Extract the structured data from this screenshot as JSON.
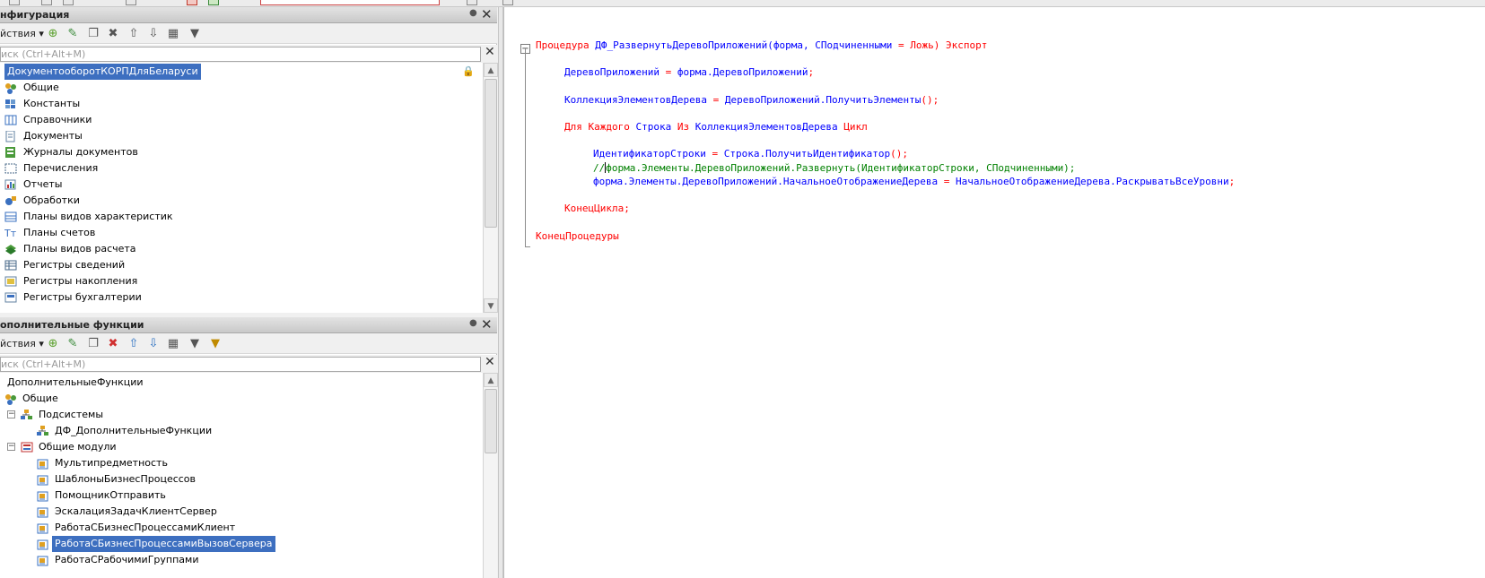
{
  "config_panel": {
    "title": "нфигурация",
    "actions_label": "йствия",
    "search_placeholder": "иск (Ctrl+Alt+M)",
    "root_label": "ДокументооборотКОРПДляБеларуси",
    "items": [
      {
        "label": "Общие",
        "icon": "common-icon"
      },
      {
        "label": "Константы",
        "icon": "constants-icon"
      },
      {
        "label": "Справочники",
        "icon": "catalogs-icon"
      },
      {
        "label": "Документы",
        "icon": "documents-icon"
      },
      {
        "label": "Журналы документов",
        "icon": "document-journals-icon"
      },
      {
        "label": "Перечисления",
        "icon": "enumerations-icon"
      },
      {
        "label": "Отчеты",
        "icon": "reports-icon"
      },
      {
        "label": "Обработки",
        "icon": "data-processors-icon"
      },
      {
        "label": "Планы видов характеристик",
        "icon": "chart-of-characteristic-types-icon"
      },
      {
        "label": "Планы счетов",
        "icon": "chart-of-accounts-icon"
      },
      {
        "label": "Планы видов расчета",
        "icon": "chart-of-calculation-types-icon"
      },
      {
        "label": "Регистры сведений",
        "icon": "information-registers-icon"
      },
      {
        "label": "Регистры накопления",
        "icon": "accumulation-registers-icon"
      },
      {
        "label": "Регистры бухгалтерии",
        "icon": "accounting-registers-icon"
      }
    ]
  },
  "extra_panel": {
    "title": "ополнительные функции",
    "actions_label": "йствия",
    "search_placeholder": "иск (Ctrl+Alt+M)",
    "root_label": "ДополнительныеФункции",
    "items": [
      {
        "label": "Общие",
        "level": 0
      },
      {
        "label": "Подсистемы",
        "level": 1
      },
      {
        "label": "ДФ_ДополнительныеФункции",
        "level": 2
      },
      {
        "label": "Общие модули",
        "level": 1
      },
      {
        "label": "Мультипредметность",
        "level": 2
      },
      {
        "label": "ШаблоныБизнесПроцессов",
        "level": 2
      },
      {
        "label": "ПомощникОтправить",
        "level": 2
      },
      {
        "label": "ЭскалацияЗадачКлиентСервер",
        "level": 2
      },
      {
        "label": "РаботаСБизнесПроцессамиКлиент",
        "level": 2
      },
      {
        "label": "РаботаСБизнесПроцессамиВызовСервера",
        "level": 2,
        "selected": true
      },
      {
        "label": "РаботаСРабочимиГруппами",
        "level": 2
      }
    ]
  },
  "code": {
    "l1_kw": "Процедура",
    "l1_name": "ДФ_РазвернутьДеревоПриложений",
    "l1_params": "(форма, СПодчиненными",
    "l1_eq": " = ",
    "l1_default": "Ложь",
    "l1_close": ")",
    "l1_export": "Экспорт",
    "l2_a": "ДеревоПриложений",
    "l2_op": " = ",
    "l2_b": "форма.ДеревоПриложений",
    "l2_end": ";",
    "l3_a": "КоллекцияЭлементовДерева",
    "l3_op": " = ",
    "l3_b": "ДеревоПриложений.ПолучитьЭлементы",
    "l3_end": "();",
    "l4_for": "Для Каждого",
    "l4_var": "Строка",
    "l4_in": "Из",
    "l4_coll": "КоллекцияЭлементовДерева",
    "l4_loop": "Цикл",
    "l5_a": "ИдентификаторСтроки",
    "l5_op": " = ",
    "l5_b": "Строка.ПолучитьИдентификатор",
    "l5_end": "();",
    "l6_pre": "//",
    "l6_post": "форма.Элементы.ДеревоПриложений.Развернуть(ИдентификаторСтроки, СПодчиненными);",
    "l7_a": "форма.Элементы.ДеревоПриложений.НачальноеОтображениеДерева",
    "l7_op": " = ",
    "l7_b": "НачальноеОтображениеДерева.РаскрыватьВсеУровни",
    "l7_end": ";",
    "l8": "КонецЦикла;",
    "l9": "КонецПроцедуры"
  },
  "colors": {
    "selection": "#3d6fc0",
    "keyword": "#ff0000",
    "identifier": "#0000ff",
    "comment": "#008000"
  }
}
